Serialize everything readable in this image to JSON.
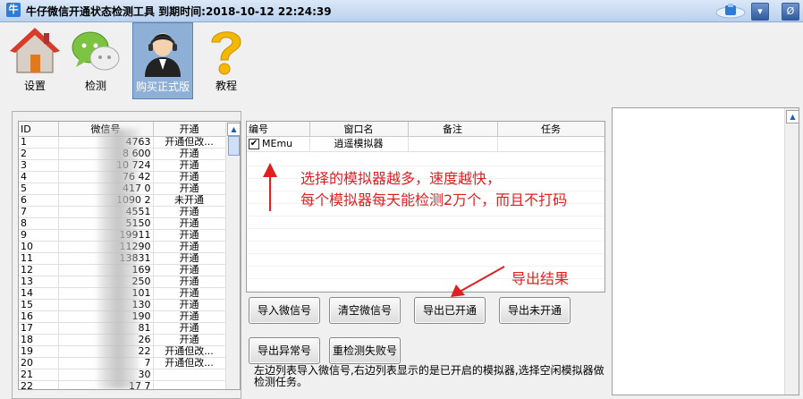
{
  "window": {
    "app_icon_char": "牛",
    "title": "牛仔微信开通状态检测工具  到期时间:2018-10-12 22:24:39",
    "min_symbol": "▾",
    "close_symbol": "Ø"
  },
  "toolbar": {
    "items": [
      {
        "label": "设置",
        "icon": "house-icon"
      },
      {
        "label": "检测",
        "icon": "chat-bubbles-icon"
      },
      {
        "label": "购买正式版",
        "icon": "support-agent-icon"
      },
      {
        "label": "教程",
        "icon": "question-mark-icon"
      }
    ]
  },
  "account_table": {
    "headers": [
      "ID",
      "微信号",
      "开通"
    ],
    "rows": [
      {
        "id": "1",
        "account": "4763",
        "status": "开通但改..."
      },
      {
        "id": "2",
        "account": "8      600",
        "status": "开通"
      },
      {
        "id": "3",
        "account": "10       724",
        "status": "开通"
      },
      {
        "id": "4",
        "account": "76       42",
        "status": "开通"
      },
      {
        "id": "5",
        "account": "417      0",
        "status": "开通"
      },
      {
        "id": "6",
        "account": "1090      2",
        "status": "未开通"
      },
      {
        "id": "7",
        "account": "4551",
        "status": "开通"
      },
      {
        "id": "8",
        "account": "5150",
        "status": "开通"
      },
      {
        "id": "9",
        "account": "19911",
        "status": "开通"
      },
      {
        "id": "10",
        "account": "11290",
        "status": "开通"
      },
      {
        "id": "11",
        "account": "13831",
        "status": "开通"
      },
      {
        "id": "12",
        "account": "169",
        "status": "开通"
      },
      {
        "id": "13",
        "account": "250",
        "status": "开通"
      },
      {
        "id": "14",
        "account": "101",
        "status": "开通"
      },
      {
        "id": "15",
        "account": "130",
        "status": "开通"
      },
      {
        "id": "16",
        "account": "190",
        "status": "开通"
      },
      {
        "id": "17",
        "account": "81",
        "status": "开通"
      },
      {
        "id": "18",
        "account": "26",
        "status": "开通"
      },
      {
        "id": "19",
        "account": "22",
        "status": "开通但改..."
      },
      {
        "id": "20",
        "account": "7",
        "status": "开通但改..."
      },
      {
        "id": "21",
        "account": "30",
        "status": ""
      },
      {
        "id": "22",
        "account": "17          7",
        "status": ""
      }
    ]
  },
  "emulator_table": {
    "headers": [
      "编号",
      "窗口名",
      "备注",
      "任务"
    ],
    "rows": [
      {
        "id": "MEmu",
        "window": "逍遥模拟器",
        "note": "",
        "task": "",
        "checked": true
      }
    ]
  },
  "annotations": {
    "line1": "选择的模拟器越多，速度越快，",
    "line2": "每个模拟器每天能检测2万个，而且不打码",
    "export_note": "导出结果"
  },
  "buttons": {
    "import": "导入微信号",
    "clear": "清空微信号",
    "export_opened": "导出已开通",
    "export_unopened": "导出未开通",
    "export_abnormal": "导出异常号",
    "recheck_failed": "重检测失败号"
  },
  "hint": "左边列表导入微信号,右边列表显示的是已开启的模拟器,选择空闲模拟器做检测任务。",
  "colors": {
    "annotation": "#e02020",
    "title_gradient_top": "#dbe8f8",
    "selected_tool": "#8fb0d6"
  }
}
